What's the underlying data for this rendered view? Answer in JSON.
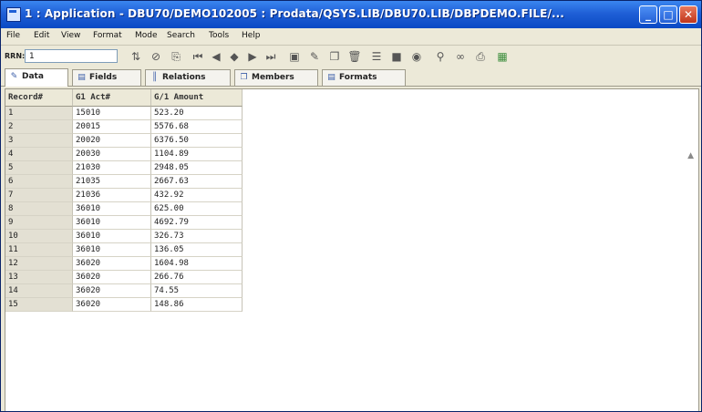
{
  "window": {
    "title": "1 : Application - DBU70/DEMO102005 : Prodata/QSYS.LIB/DBU70.LIB/DBPDEMO.FILE/..."
  },
  "menu": [
    "File",
    "Edit",
    "View",
    "Format",
    "Mode",
    "Search",
    "Tools",
    "Help"
  ],
  "toolbar": {
    "rrn_label": "RRN:",
    "rrn_value": "1",
    "icons": [
      "sort-icon",
      "filter-icon",
      "copy-icon",
      "first-icon",
      "previous-icon",
      "position-icon",
      "next-icon",
      "last-icon",
      "save-icon",
      "edit-icon",
      "duplicate-icon",
      "delete-icon",
      "fields-icon",
      "grid-icon",
      "view-icon",
      "find-icon",
      "binoculars-icon",
      "print-icon",
      "sheet-icon"
    ]
  },
  "tabs": [
    "Data",
    "Fields",
    "Relations",
    "Members",
    "Formats"
  ],
  "table": {
    "headers": [
      "Record#",
      "G1 Act#",
      "G/1 Amount"
    ],
    "rows": [
      [
        "1",
        "15010",
        "523.20"
      ],
      [
        "2",
        "20015",
        "5576.68"
      ],
      [
        "3",
        "20020",
        "6376.50"
      ],
      [
        "4",
        "20030",
        "1104.89"
      ],
      [
        "5",
        "21030",
        "2948.05"
      ],
      [
        "6",
        "21035",
        "2667.63"
      ],
      [
        "7",
        "21036",
        "432.92"
      ],
      [
        "8",
        "36010",
        "625.00"
      ],
      [
        "9",
        "36010",
        "4692.79"
      ],
      [
        "10",
        "36010",
        "326.73"
      ],
      [
        "11",
        "36010",
        "136.05"
      ],
      [
        "12",
        "36020",
        "1604.98"
      ],
      [
        "13",
        "36020",
        "266.76"
      ],
      [
        "14",
        "36020",
        "74.55"
      ],
      [
        "15",
        "36020",
        "148.86"
      ]
    ]
  },
  "colors": {
    "titlebar": "#1f5fd6",
    "close_button": "#c1361c",
    "window_bg": "#ece9d8",
    "page_bg": "#9fd6e6"
  }
}
